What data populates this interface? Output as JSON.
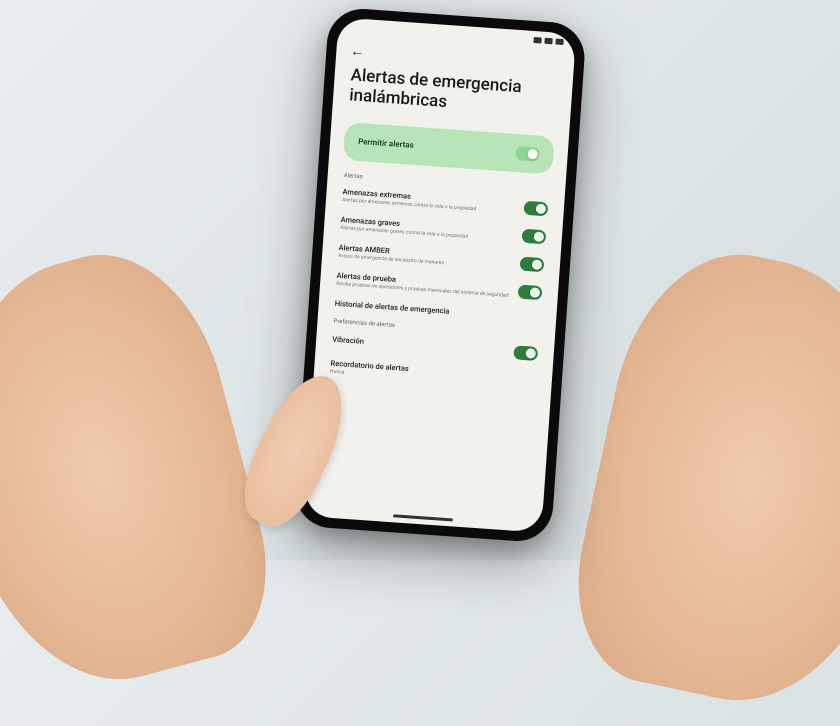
{
  "page": {
    "title": "Alertas de emergencia inalámbricas"
  },
  "allow_card": {
    "label": "Permitir alertas"
  },
  "sections": {
    "alerts_label": "Alertas",
    "prefs_label": "Preferencias de alertas"
  },
  "rows": {
    "extreme": {
      "title": "Amenazas extremas",
      "sub": "Alertas por amenazas extremas contra la vida o la propiedad"
    },
    "severe": {
      "title": "Amenazas graves",
      "sub": "Alertas por amenazas graves contra la vida o la propiedad"
    },
    "amber": {
      "title": "Alertas AMBER",
      "sub": "Avisos de emergencia de secuestro de menores"
    },
    "test": {
      "title": "Alertas de prueba",
      "sub": "Recibe pruebas de operadores y pruebas mensuales del sistema de seguridad"
    },
    "history": {
      "title": "Historial de alertas de emergencia"
    },
    "vibration": {
      "title": "Vibración"
    },
    "reminder": {
      "title": "Recordatorio de alertas",
      "sub": "Nunca"
    }
  },
  "colors": {
    "accent_light": "#b7e5b7",
    "accent_dark": "#2e7d3e",
    "background": "#f3f1ec"
  }
}
